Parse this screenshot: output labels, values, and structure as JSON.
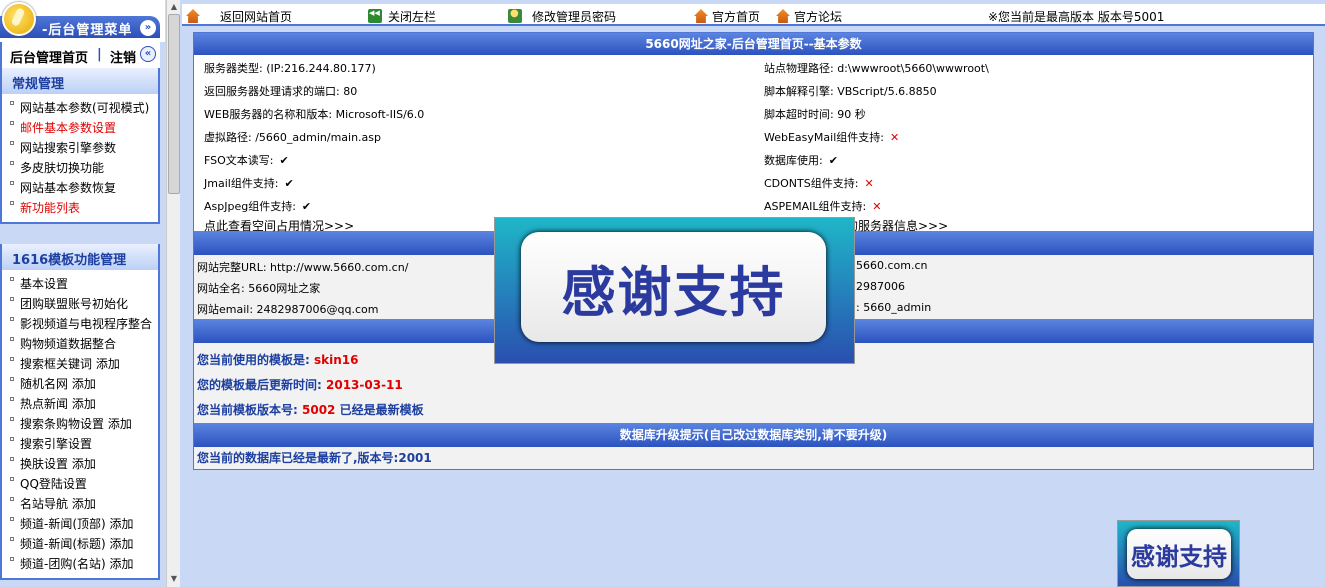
{
  "left_menu": {
    "title": "-后台管理菜单",
    "collapse_glyph": "»",
    "home_label": "后台管理首页",
    "separator": "|",
    "logout_label": "注销",
    "home_glyph": "«",
    "sections": [
      {
        "title": "常规管理",
        "items": [
          {
            "label": "网站基本参数(可视模式)",
            "red": false
          },
          {
            "label": "邮件基本参数设置",
            "red": true
          },
          {
            "label": "网站搜索引擎参数",
            "red": false
          },
          {
            "label": "多皮肤切换功能",
            "red": false
          },
          {
            "label": "网站基本参数恢复",
            "red": false
          },
          {
            "label": "新功能列表",
            "red": true
          }
        ]
      },
      {
        "title": "1616模板功能管理",
        "items": [
          {
            "label": "基本设置",
            "red": false
          },
          {
            "label": "团购联盟账号初始化",
            "red": false
          },
          {
            "label": "影视频道与电视程序整合",
            "red": false
          },
          {
            "label": "购物频道数据整合",
            "red": false
          },
          {
            "label": "搜索框关键词 添加",
            "red": false
          },
          {
            "label": "随机名网 添加",
            "red": false
          },
          {
            "label": "热点新闻 添加",
            "red": false
          },
          {
            "label": "搜索条购物设置 添加",
            "red": false
          },
          {
            "label": "搜索引擎设置",
            "red": false
          },
          {
            "label": "换肤设置 添加",
            "red": false
          },
          {
            "label": "QQ登陆设置",
            "red": false
          },
          {
            "label": "名站导航 添加",
            "red": false
          },
          {
            "label": "频道-新闻(顶部) 添加",
            "red": false
          },
          {
            "label": "频道-新闻(标题) 添加",
            "red": false
          },
          {
            "label": "频道-团购(名站) 添加",
            "red": false
          }
        ]
      }
    ]
  },
  "top_nav": {
    "back_home": "返回网站首页",
    "close_left": "关闭左栏",
    "change_password": "修改管理员密码",
    "official_home": "官方首页",
    "official_forum": "官方论坛",
    "version_note": "※您当前是最高版本 版本号5001"
  },
  "main": {
    "title": "5660网址之家-后台管理首页--基本参数",
    "params_left": [
      "服务器类型: (IP:216.244.80.177)",
      "返回服务器处理请求的端口: 80",
      "WEB服务器的名称和版本: Microsoft-IIS/6.0",
      "虚拟路径: /5660_admin/main.asp",
      "FSO文本读写:",
      "Jmail组件支持:",
      "AspJpeg组件支持:"
    ],
    "params_left_marks": [
      "",
      "",
      "",
      "",
      "✔",
      "✔",
      "✔"
    ],
    "params_right": [
      "站点物理路径: d:\\wwwroot\\5660\\wwwroot\\",
      "脚本解释引擎: VBScript/5.6.8850",
      "脚本超时时间: 90 秒",
      "WebEasyMail组件支持:",
      "数据库使用:",
      "CDONTS组件支持:",
      "ASPEMAIL组件支持:"
    ],
    "params_right_marks": [
      "",
      "",
      "",
      "✕",
      "✔",
      "✕",
      "✕"
    ],
    "space_link": "点此查看空间占用情况>>>",
    "server_info_link": "的服务器信息>>>",
    "site_left": [
      "网站完整URL: http://www.5660.com.cn/",
      "网站全名: 5660网址之家",
      "网站email: 2482987006@qq.com"
    ],
    "site_right": [
      "5660.com.cn",
      "2987006",
      ": 5660_admin"
    ],
    "template_name_label": "您当前使用的模板是:",
    "template_name_value": "skin16",
    "template_updated_label": "您的模板最后更新时间:",
    "template_updated_value": "2013-03-11",
    "template_version_label": "您当前模板版本号:",
    "template_version_value": "5002",
    "template_version_note": "已经是最新模板",
    "db_title": "数据库升级提示(自己改过数据库类别,请不要升级)",
    "db_message": "您当前的数据库已经是最新了,版本号:2001"
  },
  "banner_text": "感谢支持"
}
